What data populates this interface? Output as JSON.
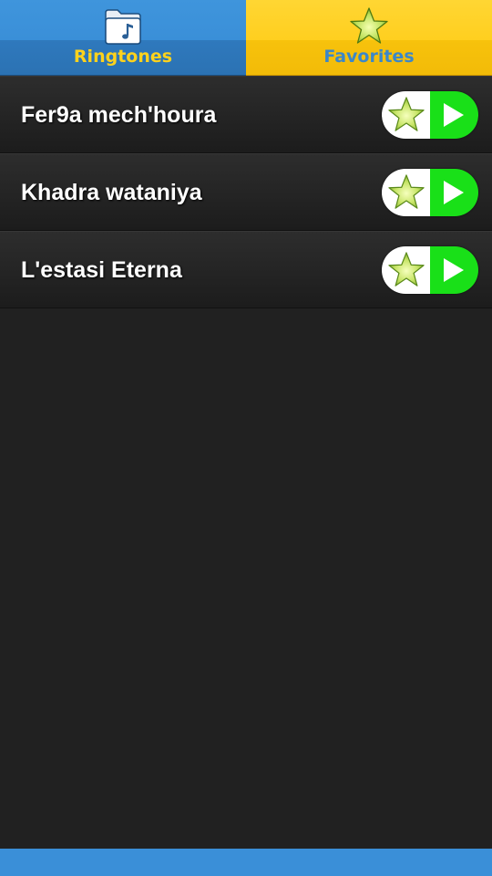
{
  "tabs": {
    "ringtones": {
      "label": "Ringtones",
      "icon": "folder-music-icon",
      "color": "#3a8fd8"
    },
    "favorites": {
      "label": "Favorites",
      "icon": "star-icon",
      "color": "#ffcf1f"
    }
  },
  "ringtones": [
    {
      "title": "Fer9a mech'houra"
    },
    {
      "title": "Khadra wataniya"
    },
    {
      "title": "L'estasi Eterna"
    }
  ],
  "row_actions": {
    "favorite_icon": "star-icon",
    "play_icon": "play-icon",
    "play_color": "#19e018"
  },
  "bottom_bar": {
    "color": "#3a8fd8"
  }
}
